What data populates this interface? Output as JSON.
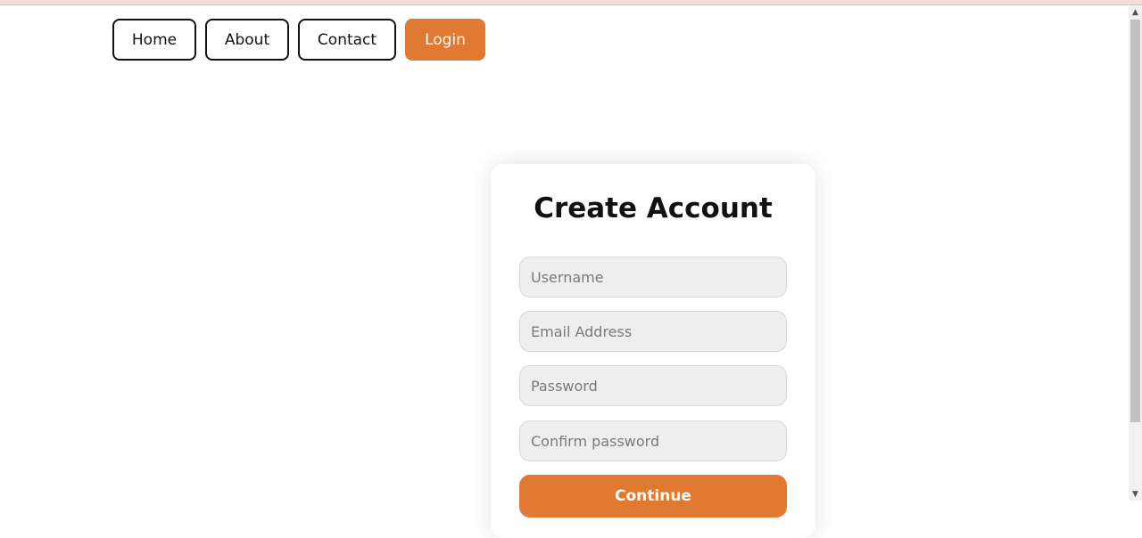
{
  "nav": {
    "items": [
      {
        "label": "Home"
      },
      {
        "label": "About"
      },
      {
        "label": "Contact"
      },
      {
        "label": "Login"
      }
    ]
  },
  "form": {
    "title": "Create Account",
    "username_placeholder": "Username",
    "email_placeholder": "Email Address",
    "password_placeholder": "Password",
    "confirm_placeholder": "Confirm password",
    "submit_label": "Continue"
  },
  "colors": {
    "accent": "#e07a30",
    "field_bg": "#eeeeee"
  },
  "icons": {
    "scroll_up": "▲",
    "scroll_down": "▼"
  }
}
